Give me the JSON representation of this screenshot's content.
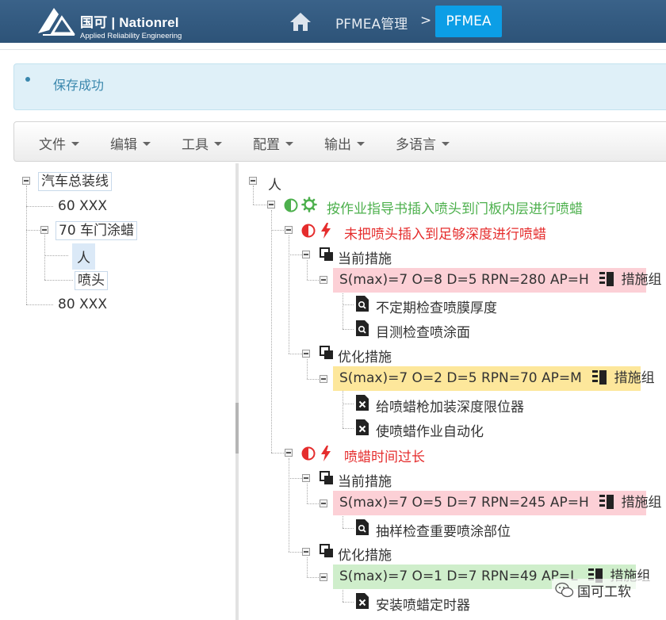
{
  "header": {
    "logo_main": "国可 | Nationrel",
    "logo_sub": "Applied Reliability Engineering",
    "breadcrumb_parent": "PFMEA管理",
    "breadcrumb_sep": ">",
    "breadcrumb_current": "PFMEA"
  },
  "alert": {
    "message": "保存成功"
  },
  "toolbar": {
    "file": "文件",
    "edit": "编辑",
    "tools": "工具",
    "config": "配置",
    "output": "输出",
    "language": "多语言"
  },
  "left_tree": {
    "root": "汽车总装线",
    "item1": "60 XXX",
    "item2": "70 车门涂蜡",
    "item2_child1": "人",
    "item2_child2": "喷头",
    "item3": "80 XXX"
  },
  "right_tree": {
    "root": "人",
    "function": "按作业指导书插入喷头到门板内层进行喷蜡",
    "failure1": {
      "label": "未把喷头插入到足够深度进行喷蜡",
      "current_label": "当前措施",
      "current_rating": "S(max)=7 O=8 D=5 RPN=280 AP=H",
      "current_group": "措施组",
      "current_actions": [
        "不定期检查喷膜厚度",
        "目测检查喷涂面"
      ],
      "optimize_label": "优化措施",
      "optimize_rating": "S(max)=7 O=2 D=5 RPN=70 AP=M",
      "optimize_group": "措施组",
      "optimize_actions": [
        "给喷蜡枪加装深度限位器",
        "使喷蜡作业自动化"
      ]
    },
    "failure2": {
      "label": "喷蜡时间过长",
      "current_label": "当前措施",
      "current_rating": "S(max)=7 O=5 D=7 RPN=245 AP=H",
      "current_group": "措施组",
      "current_actions": [
        "抽样检查重要喷涂部位"
      ],
      "optimize_label": "优化措施",
      "optimize_rating": "S(max)=7 O=1 D=7 RPN=49 AP=L",
      "optimize_group": "措施组",
      "optimize_actions": [
        "安装喷蜡定时器"
      ]
    }
  },
  "watermark": "国可工软",
  "colors": {
    "header_bg": "#33597f",
    "breadcrumb_active": "#0c9ee6",
    "alert_bg": "#dff0f8",
    "alert_text": "#3a87ad",
    "function_green": "#4db04d",
    "failure_red": "#e52d2d",
    "rating_high": "#fcd0d6",
    "rating_medium": "#fde79b",
    "rating_low": "#cfeecb"
  }
}
